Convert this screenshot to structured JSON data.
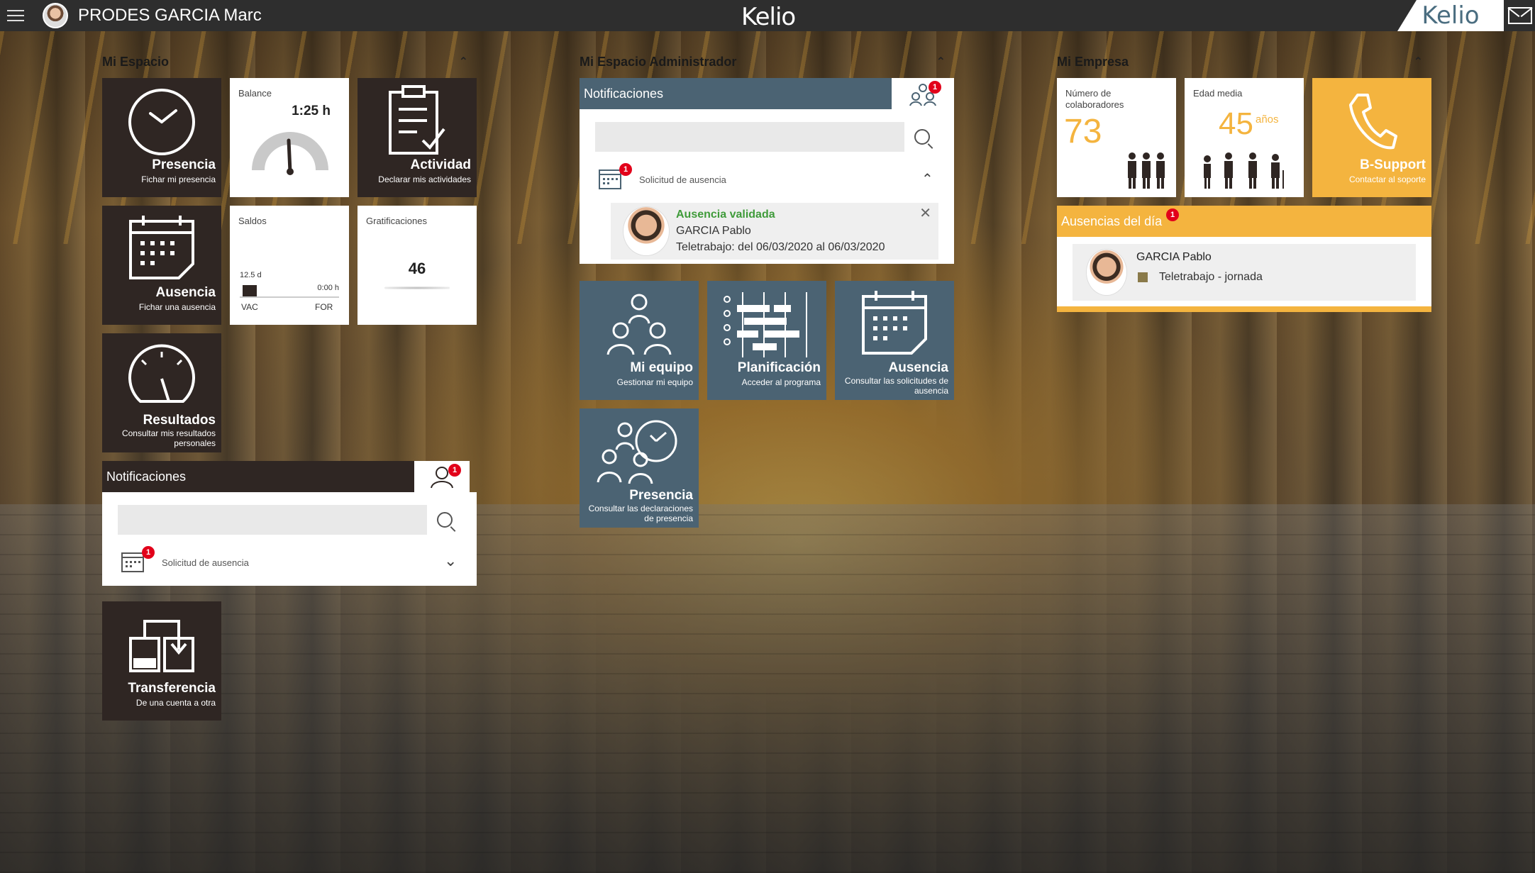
{
  "topbar": {
    "user_name": "PRODES GARCIA Marc",
    "logo_center": "Kelio",
    "logo_right": "Kelio"
  },
  "sections": {
    "mi_espacio": "Mi Espacio",
    "mi_espacio_admin": "Mi Espacio Administrador",
    "mi_empresa": "Mi Empresa"
  },
  "tiles": {
    "presencia": {
      "title": "Presencia",
      "sub": "Fichar mi presencia"
    },
    "balance": {
      "label": "Balance",
      "value": "1:25 h"
    },
    "actividad": {
      "title": "Actividad",
      "sub": "Declarar mis actividades"
    },
    "ausencia": {
      "title": "Ausencia",
      "sub": "Fichar una ausencia"
    },
    "saldos": {
      "label": "Saldos",
      "vac_value": "12.5 d",
      "for_value": "0:00 h",
      "vac_label": "VAC",
      "for_label": "FOR"
    },
    "gratificaciones": {
      "label": "Gratificaciones",
      "value": "46"
    },
    "resultados": {
      "title": "Resultados",
      "sub": "Consultar mis resultados personales"
    },
    "transferencia": {
      "title": "Transferencia",
      "sub": "De una cuenta a otra"
    }
  },
  "notif_left": {
    "title": "Notificaciones",
    "badge": "1",
    "item_label": "Solicitud de ausencia",
    "item_badge": "1"
  },
  "notif_admin": {
    "title": "Notificaciones",
    "badge": "1",
    "item_label": "Solicitud de ausencia",
    "item_badge": "1",
    "card_status": "Ausencia validada",
    "card_name": "GARCIA Pablo",
    "card_detail": "Teletrabajo: del 06/03/2020 al 06/03/2020"
  },
  "admin_tiles": {
    "mi_equipo": {
      "title": "Mi equipo",
      "sub": "Gestionar mi equipo"
    },
    "planificacion": {
      "title": "Planificación",
      "sub": "Acceder al programa"
    },
    "ausencia": {
      "title": "Ausencia",
      "sub": "Consultar las solicitudes de ausencia"
    },
    "presencia": {
      "title": "Presencia",
      "sub": "Consultar las declaraciones de presencia"
    }
  },
  "empresa": {
    "colaboradores": {
      "label": "Número de colaboradores",
      "value": "73"
    },
    "edad": {
      "label": "Edad media",
      "value": "45",
      "unit": "años"
    },
    "bsupport": {
      "title": "B-Support",
      "sub": "Contactar al soporte"
    },
    "ausencias_dia": {
      "title": "Ausencias del día",
      "badge": "1",
      "name": "GARCIA Pablo",
      "detail": "Teletrabajo - jornada"
    }
  },
  "colors": {
    "dark_tile": "#2f2623",
    "blue_tile": "#4b6373",
    "orange_tile": "#f4b43f",
    "validated_green": "#3f9b3a",
    "badge_red": "#e2001a"
  }
}
